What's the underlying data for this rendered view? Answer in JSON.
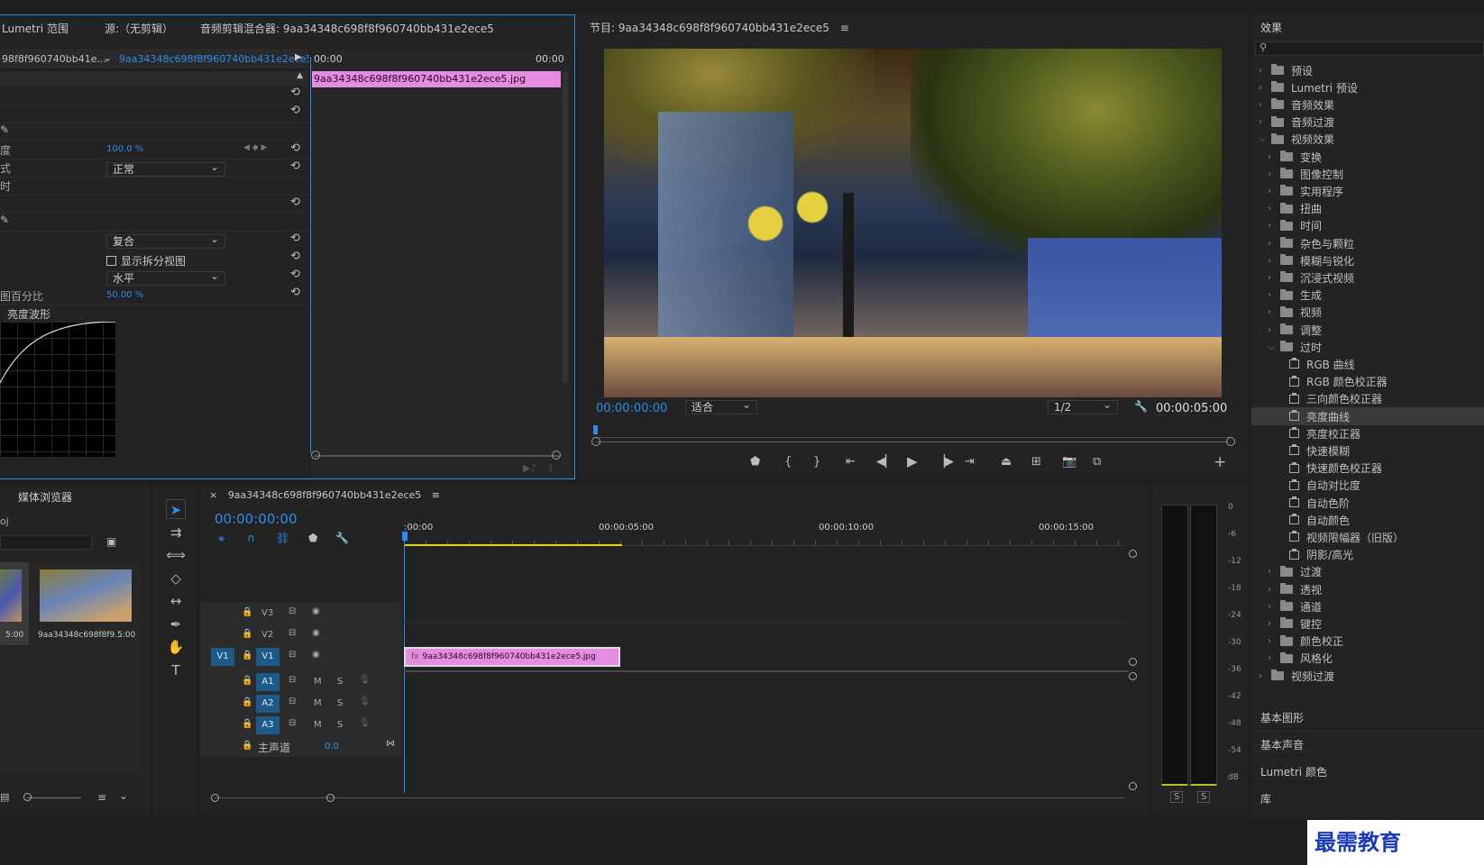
{
  "source_panel": {
    "tabs": [
      "Lumetri 范围",
      "源:（无剪辑）",
      "音频剪辑混合器: 9aa34348c698f8f960740bb431e2ece5"
    ],
    "clip_selector_left": "98f8f960740bb41e...",
    "clip_selector_right": "9aa34348c698f8f960740bb431e2ece5...",
    "mini_timecode_start": "00:00",
    "mini_timecode_end": "00:00",
    "clip_label": "9aa34348c698f8f960740bb431e2ece5.jpg",
    "opacity_label": "度",
    "opacity_value": "100.0 %",
    "blend_label": "式",
    "blend_value": "正常",
    "time_label": "时",
    "mode_value": "复合",
    "split_view_label": "显示拆分视图",
    "orientation_value": "水平",
    "split_percent_label": "图百分比",
    "split_percent_value": "50.00 %",
    "curve_title": "亮度波形"
  },
  "program_monitor": {
    "title": "节目: 9aa34348c698f8f960740bb431e2ece5",
    "timecode": "00:00:00:00",
    "fit": "适合",
    "resolution": "1/2",
    "duration": "00:00:05:00"
  },
  "effects_panel": {
    "title": "效果",
    "search_placeholder": "",
    "items": [
      {
        "label": "预设",
        "level": 0,
        "type": "folder",
        "open": false
      },
      {
        "label": "Lumetri 预设",
        "level": 0,
        "type": "folder",
        "open": false
      },
      {
        "label": "音频效果",
        "level": 0,
        "type": "folder",
        "open": false
      },
      {
        "label": "音频过渡",
        "level": 0,
        "type": "folder",
        "open": false
      },
      {
        "label": "视频效果",
        "level": 0,
        "type": "folder",
        "open": true
      },
      {
        "label": "变换",
        "level": 1,
        "type": "folder",
        "open": false
      },
      {
        "label": "图像控制",
        "level": 1,
        "type": "folder",
        "open": false
      },
      {
        "label": "实用程序",
        "level": 1,
        "type": "folder",
        "open": false
      },
      {
        "label": "扭曲",
        "level": 1,
        "type": "folder",
        "open": false
      },
      {
        "label": "时间",
        "level": 1,
        "type": "folder",
        "open": false
      },
      {
        "label": "杂色与颗粒",
        "level": 1,
        "type": "folder",
        "open": false
      },
      {
        "label": "模糊与锐化",
        "level": 1,
        "type": "folder",
        "open": false
      },
      {
        "label": "沉浸式视频",
        "level": 1,
        "type": "folder",
        "open": false
      },
      {
        "label": "生成",
        "level": 1,
        "type": "folder",
        "open": false
      },
      {
        "label": "视频",
        "level": 1,
        "type": "folder",
        "open": false
      },
      {
        "label": "调整",
        "level": 1,
        "type": "folder",
        "open": false
      },
      {
        "label": "过时",
        "level": 1,
        "type": "folder",
        "open": true
      },
      {
        "label": "RGB 曲线",
        "level": 2,
        "type": "effect"
      },
      {
        "label": "RGB 颜色校正器",
        "level": 2,
        "type": "effect"
      },
      {
        "label": "三向颜色校正器",
        "level": 2,
        "type": "effect"
      },
      {
        "label": "亮度曲线",
        "level": 2,
        "type": "effect",
        "selected": true
      },
      {
        "label": "亮度校正器",
        "level": 2,
        "type": "effect"
      },
      {
        "label": "快速模糊",
        "level": 2,
        "type": "effect"
      },
      {
        "label": "快速颜色校正器",
        "level": 2,
        "type": "effect"
      },
      {
        "label": "自动对比度",
        "level": 2,
        "type": "effect"
      },
      {
        "label": "自动色阶",
        "level": 2,
        "type": "effect"
      },
      {
        "label": "自动颜色",
        "level": 2,
        "type": "effect"
      },
      {
        "label": "视频限幅器（旧版）",
        "level": 2,
        "type": "effect"
      },
      {
        "label": "阴影/高光",
        "level": 2,
        "type": "effect"
      },
      {
        "label": "过渡",
        "level": 1,
        "type": "folder",
        "open": false
      },
      {
        "label": "透视",
        "level": 1,
        "type": "folder",
        "open": false
      },
      {
        "label": "通道",
        "level": 1,
        "type": "folder",
        "open": false
      },
      {
        "label": "键控",
        "level": 1,
        "type": "folder",
        "open": false
      },
      {
        "label": "颜色校正",
        "level": 1,
        "type": "folder",
        "open": false
      },
      {
        "label": "风格化",
        "level": 1,
        "type": "folder",
        "open": false
      },
      {
        "label": "视频过渡",
        "level": 0,
        "type": "folder",
        "open": false
      }
    ],
    "bottom_sections": [
      "基本图形",
      "基本声音",
      "Lumetri 颜色",
      "库"
    ]
  },
  "media_browser": {
    "title": "媒体浏览器",
    "project_text": "oj",
    "thumb1_duration": "5:00",
    "thumb2_name": "9aa34348c698f8f9...",
    "thumb2_duration": "5:00"
  },
  "timeline": {
    "sequence_name": "9aa34348c698f8f960740bb431e2ece5",
    "timecode": "00:00:00:00",
    "ruler": [
      ":00:00",
      "00:00:05:00",
      "00:00:10:00",
      "00:00:15:00"
    ],
    "video_tracks": [
      "V3",
      "V2",
      "V1"
    ],
    "source_patch": "V1",
    "audio_tracks": [
      "A1",
      "A2",
      "A3"
    ],
    "mute_label": "M",
    "solo_label": "S",
    "master_label": "主声道",
    "master_value": "0.0",
    "clip_label": "9aa34348c698f8f960740bb431e2ece5.jpg"
  },
  "audio_meter": {
    "scale": [
      "0",
      "-6",
      "-12",
      "-18",
      "-24",
      "-30",
      "-36",
      "-42",
      "-48",
      "-54",
      "dB"
    ],
    "solo_buttons": [
      "S",
      "S"
    ]
  },
  "watermark": "最需教育"
}
